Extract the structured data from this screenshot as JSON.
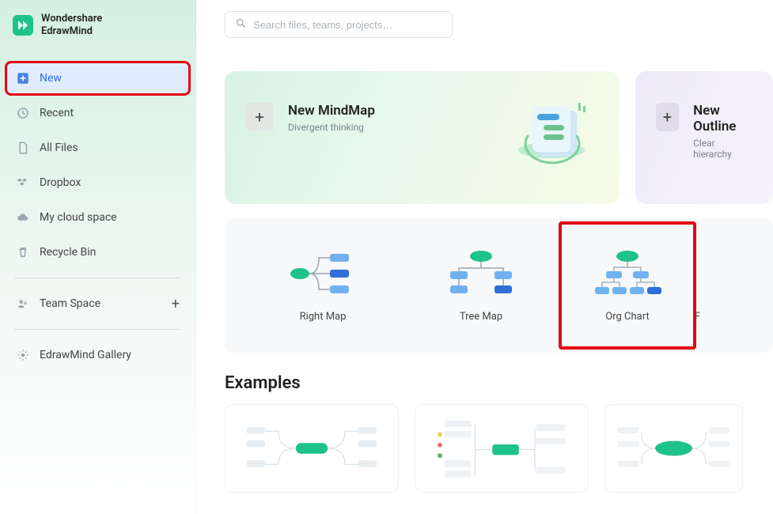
{
  "app": {
    "brand_line1": "Wondershare",
    "brand_line2": "EdrawMind"
  },
  "search": {
    "placeholder": "Search files, teams, projects…"
  },
  "sidebar": {
    "items": {
      "new": {
        "label": "New"
      },
      "recent": {
        "label": "Recent"
      },
      "all_files": {
        "label": "All Files"
      },
      "dropbox": {
        "label": "Dropbox"
      },
      "cloud": {
        "label": "My cloud space"
      },
      "recycle": {
        "label": "Recycle Bin"
      },
      "team_space": {
        "label": "Team Space"
      },
      "gallery": {
        "label": "EdrawMind Gallery"
      }
    }
  },
  "hero": {
    "mindmap": {
      "title": "New MindMap",
      "subtitle": "Divergent thinking"
    },
    "outline": {
      "title": "New Outline",
      "subtitle": "Clear hierarchy"
    }
  },
  "templates": {
    "right_map": {
      "label": "Right Map"
    },
    "tree_map": {
      "label": "Tree Map"
    },
    "org_chart": {
      "label": "Org Chart"
    },
    "next_partial": {
      "label": "F"
    }
  },
  "sections": {
    "examples": "Examples"
  },
  "colors": {
    "accent_green": "#1ec28b",
    "accent_blue": "#2b6de0",
    "highlight_red": "#e30613"
  }
}
